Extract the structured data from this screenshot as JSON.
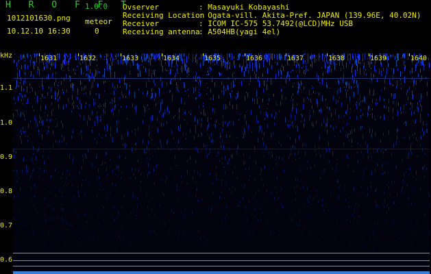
{
  "app": {
    "name": "H R O F F T",
    "version": "1.0.0"
  },
  "file": {
    "filename": "1012101630.png",
    "datetime": "10.12.10 16:30"
  },
  "meteor": {
    "label": "meteor",
    "count": "0"
  },
  "info": [
    {
      "label": "Ovserver",
      "value": ": Masayuki Kobayashi"
    },
    {
      "label": "Receiving Location",
      "value": ": Ogata-vill. Akita-Pref. JAPAN (139.96E, 40.02N)"
    },
    {
      "label": "Receiver",
      "value": ": ICOM IC-575 53.7492(@LCD)MHz USB"
    },
    {
      "label": "Receiving antenna",
      "value": ": A504HB(yagi 4el)"
    }
  ],
  "axis": {
    "y_unit": "kHz",
    "y_ticks": [
      "1.1",
      "1.0",
      "0.9",
      "0.8",
      "0.7",
      "0.6"
    ],
    "x_ticks": [
      "1631",
      "1632",
      "1633",
      "1634",
      "1635",
      "1636",
      "1637",
      "1638",
      "1639",
      "1640"
    ]
  },
  "colors": {
    "label_green": "#22d422",
    "tick_yellow": "#f0f000",
    "signal_blue": "#2a4cff",
    "background": "#000000"
  }
}
